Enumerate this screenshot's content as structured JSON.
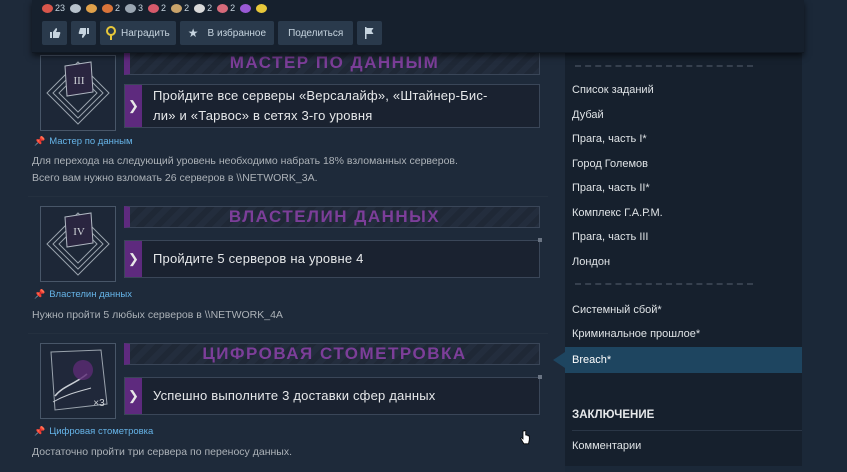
{
  "awards": [
    {
      "icon": "award-fish-icon",
      "color": "#d8564b",
      "count": "23"
    },
    {
      "icon": "award-bird-icon",
      "color": "#b7c2cc",
      "count": ""
    },
    {
      "icon": "award-cookie-icon",
      "color": "#e0a14a",
      "count": ""
    },
    {
      "icon": "award-animal-icon",
      "color": "#d9743a",
      "count": "2"
    },
    {
      "icon": "award-headphones-icon",
      "color": "#9aa6b2",
      "count": "3"
    },
    {
      "icon": "award-flag-icon",
      "color": "#d65a6b",
      "count": "2"
    },
    {
      "icon": "award-figure-icon",
      "color": "#c9a36a",
      "count": "2"
    },
    {
      "icon": "award-trophy-icon",
      "color": "#d9d9d9",
      "count": "2"
    },
    {
      "icon": "award-heart-icon",
      "color": "#d66a7a",
      "count": "2"
    },
    {
      "icon": "award-blob-icon",
      "color": "#9a5ad6",
      "count": ""
    },
    {
      "icon": "award-sun-icon",
      "color": "#e8c83a",
      "count": ""
    }
  ],
  "actions": {
    "award": "Наградить",
    "favorite": "В избранное",
    "share": "Поделиться"
  },
  "achievements": [
    {
      "title": "МАСТЕР ПО ДАННЫМ",
      "numeral": "III",
      "desc_lines": [
        "Пройдите все серверы «Версалайф», «Штайнер-Бис-",
        "ли» и «Тарвос» в сетях 3-го уровня"
      ],
      "caption": "Мастер по данным",
      "note_lines": [
        "Для перехода на следующий уровень необходимо набрать 18% взломанных серверов.",
        "Всего вам нужно взломать 26 серверов в \\\\NETWORK_3A."
      ]
    },
    {
      "title": "ВЛАСТЕЛИН ДАННЫХ",
      "numeral": "IV",
      "desc_lines": [
        "Пройдите 5 серверов на уровне 4"
      ],
      "caption": "Властелин данных",
      "note_lines": [
        "Нужно пройти 5 любых серверов в \\\\NETWORK_4A"
      ]
    },
    {
      "title": "ЦИФРОВАЯ СТОМЕТРОВКА",
      "numeral": "×3",
      "desc_lines": [
        "Успешно выполните 3 доставки сфер данных"
      ],
      "caption": "Цифровая стометровка",
      "note_lines": [
        "Достаточно пройти три сервера по переносу данных."
      ]
    }
  ],
  "sidebar": {
    "group1": [
      "Список заданий",
      "Дубай",
      "Прага, часть I*",
      "Город Големов",
      "Прага, часть II*",
      "Комплекс Г.А.Р.М.",
      "Прага, часть III",
      "Лондон"
    ],
    "group2": [
      "Системный сбой*",
      "Криминальное прошлое*"
    ],
    "active": "Breach*",
    "heading": "ЗАКЛЮЧЕНИЕ",
    "comments": "Комментарии"
  }
}
